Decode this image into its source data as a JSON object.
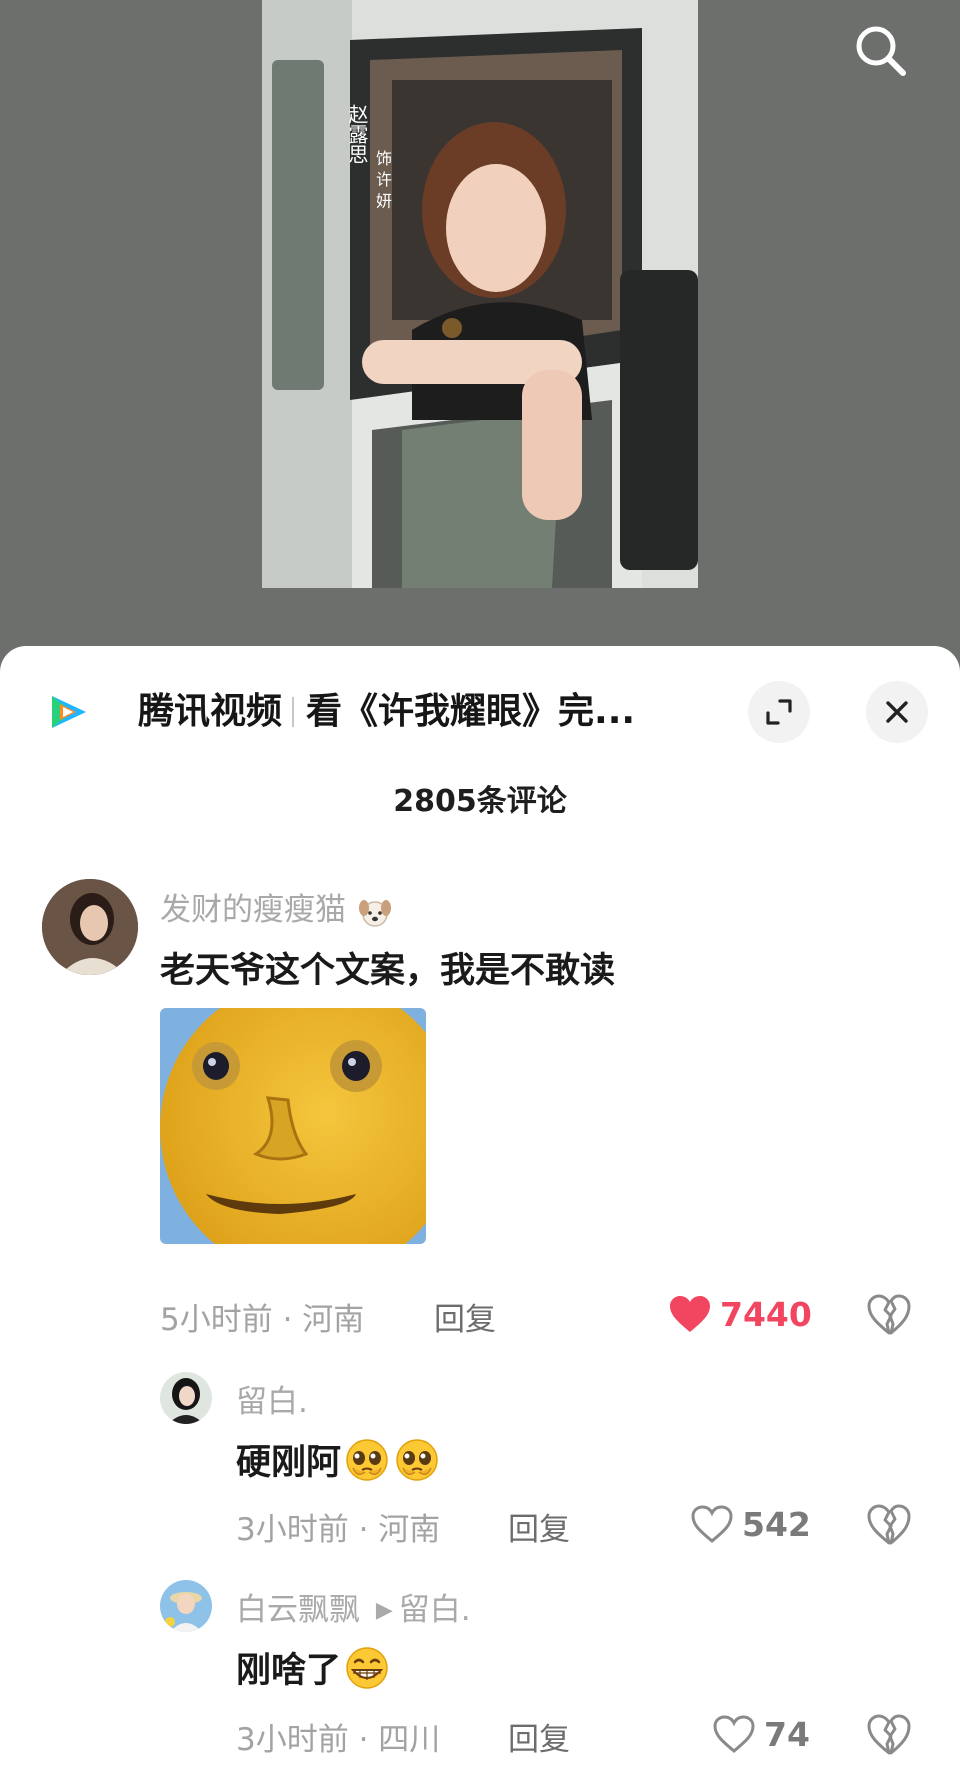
{
  "video": {
    "poster_vertical_text": "赵露思",
    "poster_role_text": "饰 许 妍"
  },
  "banner": {
    "app_name": "腾讯视频",
    "title": "看《许我耀眼》完..."
  },
  "comments_header": {
    "count_label": "2805条评论"
  },
  "comments": [
    {
      "username": "发财的瘦瘦猫",
      "username_emoji": "dog-face-icon",
      "text": "老天爷这个文案，我是不敢读",
      "sticker": "yellow-face-sticker",
      "time_location": "5小时前 · 河南",
      "reply_label": "回复",
      "likes": "7440",
      "liked": true
    },
    {
      "username": "留白.",
      "text": "硬刚阿",
      "emojis": [
        "pleading-face-icon",
        "pleading-face-icon"
      ],
      "time_location": "3小时前 · 河南",
      "reply_label": "回复",
      "likes": "542",
      "liked": false
    },
    {
      "username": "白云飘飘",
      "reply_to": "留白.",
      "text": "刚啥了",
      "emojis": [
        "grinning-face-icon"
      ],
      "time_location": "3小时前 · 四川",
      "reply_label": "回复",
      "likes": "74",
      "liked": false
    }
  ],
  "colors": {
    "like_red": "#f2455f",
    "sheet_bg": "#ffffff",
    "backdrop": "#6f716f"
  }
}
